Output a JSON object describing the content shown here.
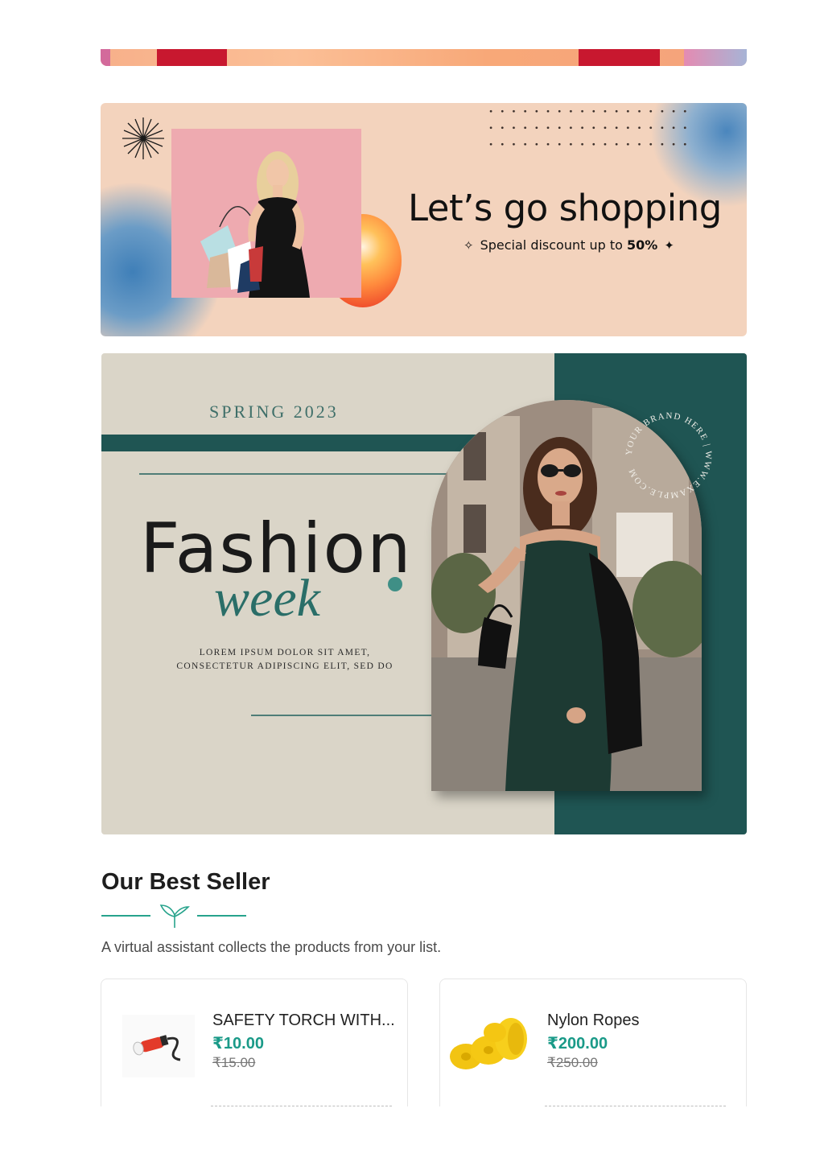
{
  "shop_banner": {
    "title": "Let’s go shopping",
    "subtitle_prefix": "Special discount up to ",
    "subtitle_highlight": "50%"
  },
  "fashion_banner": {
    "season": "SPRING 2023",
    "headline": "Fashion",
    "script": "week",
    "tagline_line1": "LOREM IPSUM DOLOR SIT AMET,",
    "tagline_line2": "CONSECTETUR ADIPISCING ELIT, SED DO",
    "circle_text": "YOUR BRAND HERE | WWW.EXAMPLE.COM"
  },
  "best_seller": {
    "title": "Our Best Seller",
    "description": "A virtual assistant collects the products from your list.",
    "products": [
      {
        "name": "SAFETY TORCH WITH...",
        "price": "₹10.00",
        "mrp": "₹15.00"
      },
      {
        "name": "Nylon Ropes",
        "price": "₹200.00",
        "mrp": "₹250.00"
      }
    ]
  },
  "colors": {
    "accent": "#1a9a88",
    "fashion_teal": "#1f5553",
    "shop_peach": "#f3d3bd"
  }
}
